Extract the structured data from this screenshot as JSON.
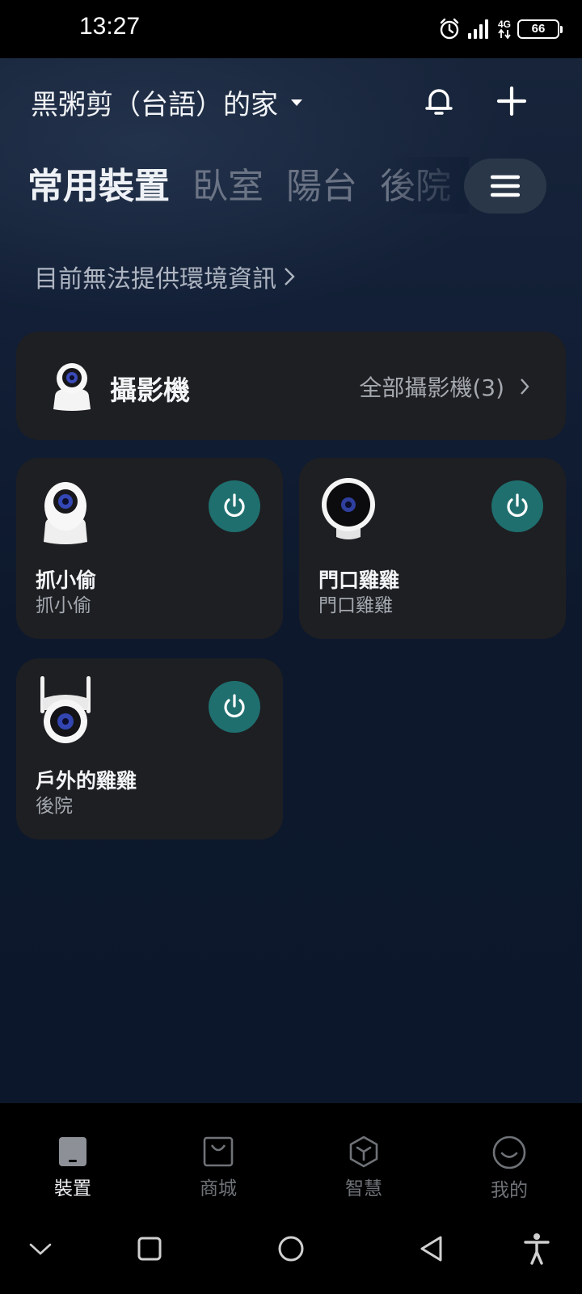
{
  "status_bar": {
    "time": "13:27",
    "network": "4G",
    "battery": "66",
    "icons": [
      "alarm-icon",
      "signal-icon",
      "data-arrows-icon",
      "battery-icon"
    ]
  },
  "header": {
    "home_name": "黑粥剪（台語）的家",
    "icons": [
      "dropdown-caret-icon",
      "bell-icon",
      "plus-icon"
    ]
  },
  "tabs": [
    {
      "label": "常用裝置",
      "active": true
    },
    {
      "label": "臥室",
      "active": false
    },
    {
      "label": "陽台",
      "active": false
    },
    {
      "label": "後院",
      "active": false
    }
  ],
  "env_info": "目前無法提供環境資訊",
  "camera_banner": {
    "title": "攝影機",
    "link": "全部攝影機(3)"
  },
  "devices": [
    {
      "name": "抓小偷",
      "room": "抓小偷",
      "icon": "pan-tilt-camera-icon"
    },
    {
      "name": "門口雞雞",
      "room": "門口雞雞",
      "icon": "stand-camera-icon"
    },
    {
      "name": "戶外的雞雞",
      "room": "後院",
      "icon": "outdoor-camera-icon"
    }
  ],
  "bottom_nav": [
    {
      "label": "裝置",
      "icon": "device-icon",
      "active": true
    },
    {
      "label": "商城",
      "icon": "shop-bag-icon",
      "active": false
    },
    {
      "label": "智慧",
      "icon": "hexagon-cube-icon",
      "active": false
    },
    {
      "label": "我的",
      "icon": "smile-face-icon",
      "active": false
    }
  ],
  "colors": {
    "power_button": "#1f6f6f",
    "card_bg": "#1e1f22",
    "app_bg": "#0d182c"
  }
}
